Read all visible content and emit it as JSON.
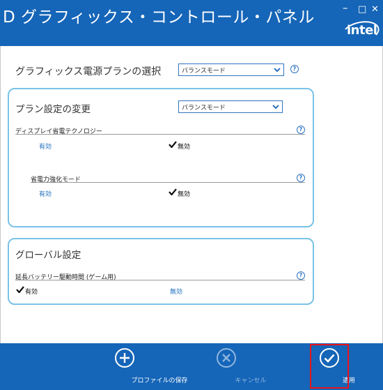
{
  "window": {
    "title": "D グラフィックス・コントロール・パネル",
    "controls": {
      "minimize": "–",
      "maximize": "□",
      "close": "✕"
    },
    "logo_text": "intel"
  },
  "power_plan": {
    "label": "グラフィックス電源プランの選択",
    "selected": "バランスモード",
    "help": "?"
  },
  "plan_settings": {
    "title": "プラン設定の変更",
    "selected": "バランスモード",
    "settings": [
      {
        "label": "ディスプレイ省電テクノロジー",
        "enable_label": "有効",
        "disable_label": "無効",
        "current": "disable",
        "help": "?"
      },
      {
        "label": "省電力強化モード",
        "enable_label": "有効",
        "disable_label": "無効",
        "current": "disable",
        "help": "?"
      }
    ]
  },
  "global_settings": {
    "title": "グローバル設定",
    "settings": [
      {
        "label": "延長バッテリー駆動時間 (ゲーム用)",
        "enable_label": "有効",
        "disable_label": "無効",
        "current": "enable",
        "help": "?"
      }
    ]
  },
  "footer": {
    "save_label": "プロファイルの保存",
    "cancel_label": "キャンセル",
    "apply_label": "適用"
  },
  "colors": {
    "brand_blue": "#1565b8",
    "group_border": "#79c2e8",
    "link_blue": "#1f6fc0",
    "highlight_red": "#e8151b"
  }
}
